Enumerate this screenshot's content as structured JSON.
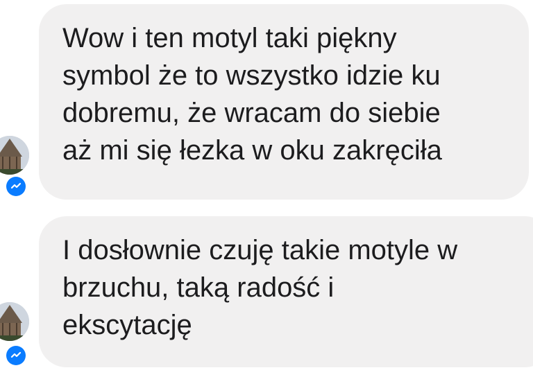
{
  "conversation": {
    "messages": [
      {
        "lines": [
          "Wow i ten motyl taki piękny",
          "symbol że to wszystko idzie ku",
          "dobremu, że wracam do siebie",
          "aż mi się łezka w oku zakręciła"
        ]
      },
      {
        "lines": [
          "I dosłownie czuję takie motyle w",
          "brzuchu, taką radość i",
          "ekscytację"
        ]
      }
    ],
    "sender_badge_icon": "messenger-icon"
  },
  "colors": {
    "bubble_background": "#f1f0f0",
    "text": "#1c1c1e",
    "messenger_blue": "#0a7cff"
  }
}
